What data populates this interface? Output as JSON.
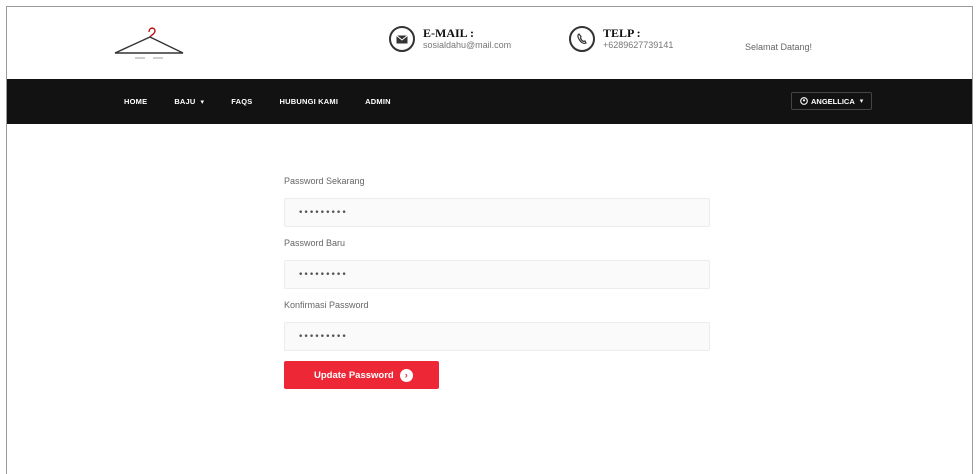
{
  "header": {
    "email": {
      "label": "E-MAIL :",
      "value": "sosialdahu@mail.com",
      "icon": "envelope-icon"
    },
    "phone": {
      "label": "TELP :",
      "value": "+6289627739141",
      "icon": "phone-icon"
    },
    "greeting": "Selamat Datang!",
    "logo_icon": "hanger-icon"
  },
  "nav": {
    "items": [
      "HOME",
      "BAJU",
      "FAQS",
      "HUBUNGI KAMI",
      "ADMIN"
    ],
    "baju_caret": "▾",
    "user_label": "ANGELLICA",
    "user_icon": "user-icon",
    "user_caret": "▾"
  },
  "form": {
    "current": {
      "label": "Password Sekarang",
      "value": "•••••••••"
    },
    "new": {
      "label": "Password Baru",
      "value": "•••••••••"
    },
    "confirm": {
      "label": "Konfirmasi Password",
      "value": "•••••••••"
    },
    "submit_label": "Update Password",
    "submit_icon": "arrow-right-circle-icon"
  },
  "colors": {
    "accent": "#ee2737",
    "navbar": "#121212",
    "background": "#ffffff"
  }
}
